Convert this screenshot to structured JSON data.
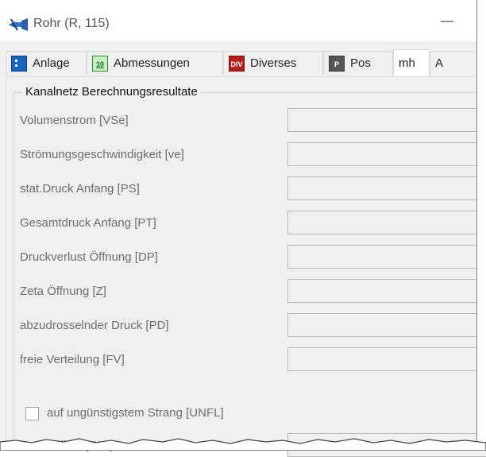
{
  "window": {
    "title": "Rohr (R, 115)",
    "minimize_glyph": "—",
    "app_icon": "pipe-icon"
  },
  "tabs": [
    {
      "label": "Anlage",
      "icon": "anlage-icon",
      "active": false
    },
    {
      "label": "Abmessungen",
      "icon": "abmessungen-icon",
      "icon_text": "10",
      "active": false
    },
    {
      "label": "Diverses",
      "icon": "diverses-icon",
      "icon_text": "DIV",
      "active": false
    },
    {
      "label": "Pos",
      "icon": "pos-icon",
      "icon_text": "P",
      "active": false
    },
    {
      "label": "mh",
      "active": true
    },
    {
      "label": "A",
      "active": false
    }
  ],
  "group": {
    "title": "Kanalnetz Berechnungsresultate"
  },
  "fields": [
    {
      "label": "Volumenstrom [VSe]",
      "value": ""
    },
    {
      "label": "Strömungsgeschwindigkeit [ve]",
      "value": ""
    },
    {
      "label": "stat.Druck Anfang [PS]",
      "value": ""
    },
    {
      "label": "Gesamtdruck Anfang [PT]",
      "value": ""
    },
    {
      "label": "Druckverlust Öffnung [DP]",
      "value": ""
    },
    {
      "label": "Zeta Öffnung [Z]",
      "value": ""
    },
    {
      "label": "abzudrosselnder Druck [PD]",
      "value": ""
    },
    {
      "label": "freie Verteilung [FV]",
      "value": ""
    }
  ],
  "checkbox": {
    "label": "auf ungünstigstem Strang [UNFL]",
    "checked": false
  },
  "protocol": {
    "label": "Protokoll-ID [CID]",
    "value": ""
  },
  "colors": {
    "panel_bg": "#f0f0f0",
    "label_disabled": "#6d6d6d",
    "field_border": "#b8b8b8"
  }
}
